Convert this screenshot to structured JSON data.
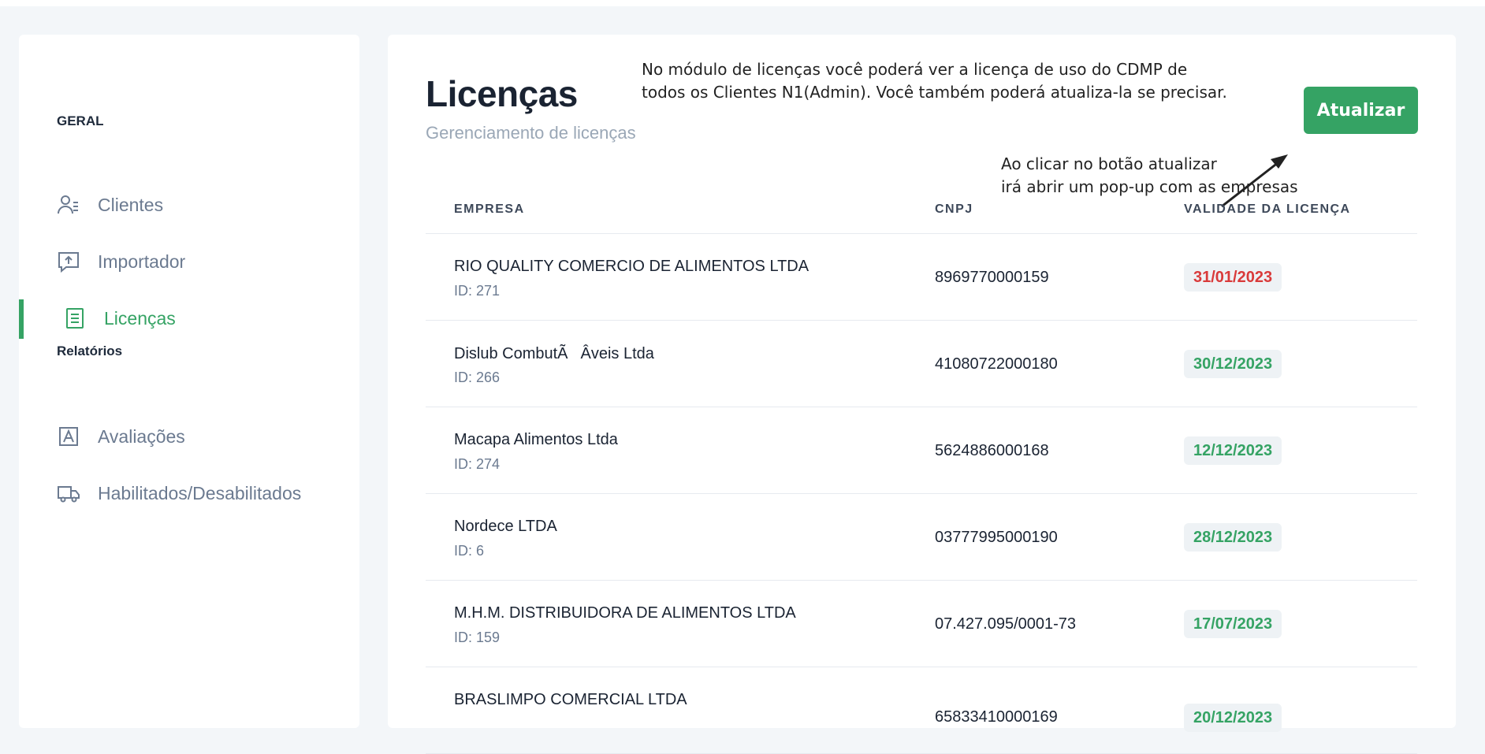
{
  "sidebar": {
    "section_general": "GERAL",
    "section_reports": "Relatórios",
    "items": [
      {
        "label": "Clientes",
        "icon": "users-list-icon"
      },
      {
        "label": "Importador",
        "icon": "upload-message-icon"
      },
      {
        "label": "Licenças",
        "icon": "document-list-icon",
        "active": true
      },
      {
        "label": "Avaliações",
        "icon": "letter-a-icon"
      },
      {
        "label": "Habilitados/Desabilitados",
        "icon": "truck-icon"
      }
    ]
  },
  "main": {
    "title": "Licenças",
    "subtitle": "Gerenciamento de licenças",
    "update_button": "Atualizar",
    "annotation_top_line1": "No módulo de licenças você poderá ver a licença de uso do CDMP de",
    "annotation_top_line2": "todos os Clientes N1(Admin). Você também poderá atualiza-la se precisar.",
    "annotation_arrow_line1": "Ao clicar no botão atualizar",
    "annotation_arrow_line2": "irá abrir um pop-up com as empresas",
    "table": {
      "headers": [
        "EMPRESA",
        "CNPJ",
        "VALIDADE DA LICENÇA"
      ],
      "rows": [
        {
          "name": "RIO QUALITY COMERCIO DE ALIMENTOS LTDA",
          "id": "ID: 271",
          "cnpj": "8969770000159",
          "validity": "31/01/2023",
          "status": "expired"
        },
        {
          "name": "Dislub CombutÃÂveis Ltda",
          "id": "ID: 266",
          "cnpj": "41080722000180",
          "validity": "30/12/2023",
          "status": "valid"
        },
        {
          "name": "Macapa Alimentos Ltda",
          "id": "ID: 274",
          "cnpj": "5624886000168",
          "validity": "12/12/2023",
          "status": "valid"
        },
        {
          "name": "Nordece LTDA",
          "id": "ID: 6",
          "cnpj": "03777995000190",
          "validity": "28/12/2023",
          "status": "valid"
        },
        {
          "name": "M.H.M. DISTRIBUIDORA DE ALIMENTOS LTDA",
          "id": "ID: 159",
          "cnpj": "07.427.095/0001-73",
          "validity": "17/07/2023",
          "status": "valid"
        },
        {
          "name": "BRASLIMPO COMERCIAL LTDA",
          "id": "",
          "cnpj": "65833410000169",
          "validity": "20/12/2023",
          "status": "valid"
        }
      ]
    }
  },
  "colors": {
    "accent": "#35a364",
    "expired": "#d93a3a",
    "valid": "#35a364",
    "badge_bg": "#eef2f5"
  }
}
